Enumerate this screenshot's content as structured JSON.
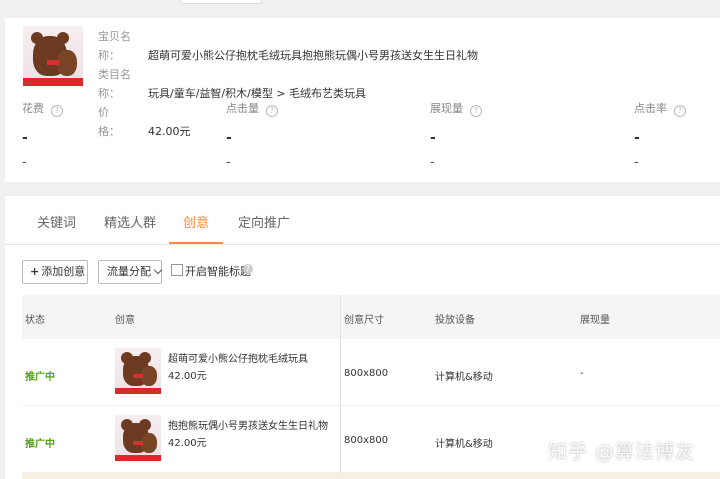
{
  "product": {
    "name_label": "宝贝名称：",
    "name": "超萌可爱小熊公仔抱枕毛绒玩具抱抱熊玩偶小号男孩送女生生日礼物",
    "category_label": "类目名称：",
    "category": "玩具/童车/益智/积木/模型 > 毛绒布艺类玩具",
    "price_label": "价　　格：",
    "price": "42.00元"
  },
  "metrics": [
    {
      "label": "花费",
      "value": "-",
      "sub": "-"
    },
    {
      "label": "点击量",
      "value": "-",
      "sub": "-"
    },
    {
      "label": "展现量",
      "value": "-",
      "sub": "-"
    },
    {
      "label": "点击率",
      "value": "-",
      "sub": "-"
    }
  ],
  "tabs": [
    "关键词",
    "精选人群",
    "创意",
    "定向推广"
  ],
  "active_tab": "创意",
  "toolbar": {
    "add_label": "添加创意",
    "flow_label": "流量分配",
    "smart_title_label": "开启智能标题"
  },
  "table": {
    "headers": [
      "状态",
      "创意",
      "创意尺寸",
      "投放设备",
      "展现量"
    ],
    "rows": [
      {
        "status": "推广中",
        "title": "超萌可爱小熊公仔抱枕毛绒玩具",
        "price": "42.00元",
        "size": "800x800",
        "device": "计算机&移动",
        "impressions": "-"
      },
      {
        "status": "推广中",
        "title": "抱抱熊玩偶小号男孩送女生生日礼物",
        "price": "42.00元",
        "size": "800x800",
        "device": "计算机&移动",
        "impressions": ""
      }
    ]
  },
  "watermark": "知乎 @算法博友",
  "colors": {
    "accent": "#ff8a3d",
    "status_green": "#52a11c"
  }
}
